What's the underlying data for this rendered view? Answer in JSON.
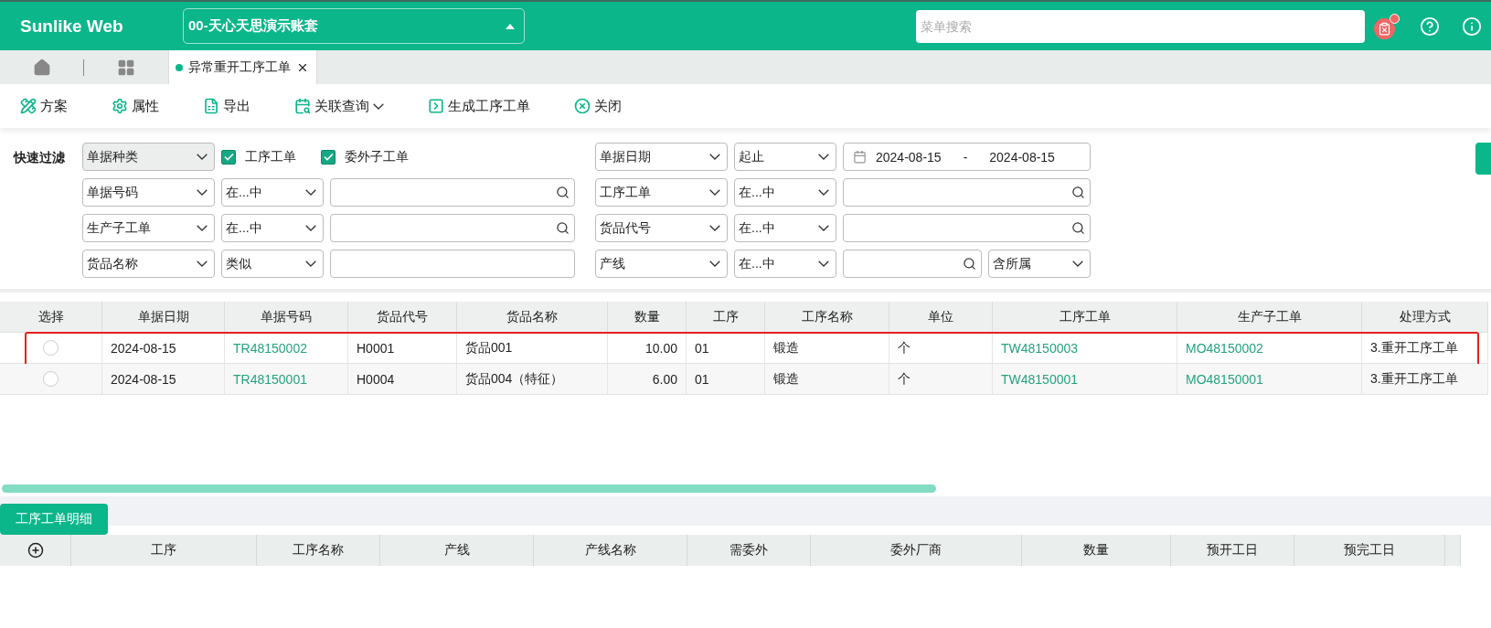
{
  "header": {
    "logo": "Sunlike Web",
    "account": {
      "value": "00-天心天思演示账套"
    },
    "search": {
      "placeholder": "菜单搜索"
    },
    "notice": {
      "unread": true
    }
  },
  "tabs": [
    {
      "label": "异常重开工序工单",
      "selected": true
    }
  ],
  "toolbar": [
    {
      "kind": "scheme",
      "label": "方案",
      "has_menu": false
    },
    {
      "kind": "property",
      "label": "属性",
      "has_menu": false
    },
    {
      "kind": "export",
      "label": "导出",
      "has_menu": false
    },
    {
      "kind": "query",
      "label": "关联查询",
      "has_menu": true
    },
    {
      "kind": "generate",
      "label": "生成工序工单",
      "has_menu": false
    },
    {
      "kind": "close",
      "label": "关闭",
      "has_menu": false
    }
  ],
  "filter": {
    "label": "快速过滤",
    "rows": [
      {
        "left": [
          {
            "kind": "select",
            "value": "单据种类",
            "disabled": true
          },
          {
            "kind": "checkbox",
            "label": "工序工单",
            "checked": true
          },
          {
            "kind": "checkbox",
            "label": "委外子工单",
            "checked": true
          }
        ],
        "right": [
          {
            "kind": "select",
            "value": "单据日期",
            "disabled": false
          },
          {
            "kind": "select",
            "value": "起止",
            "disabled": false
          },
          {
            "kind": "date_range",
            "from": "2024-08-15",
            "separator": "-",
            "to": "2024-08-15"
          }
        ]
      },
      {
        "left": [
          {
            "kind": "select",
            "value": "单据号码",
            "disabled": false
          },
          {
            "kind": "select",
            "value": "在...中",
            "disabled": false
          },
          {
            "kind": "search"
          }
        ],
        "right": [
          {
            "kind": "select",
            "value": "工序工单",
            "disabled": false
          },
          {
            "kind": "select",
            "value": "在...中",
            "disabled": false
          },
          {
            "kind": "search"
          }
        ]
      },
      {
        "left": [
          {
            "kind": "select",
            "value": "生产子工单",
            "disabled": false
          },
          {
            "kind": "select",
            "value": "在...中",
            "disabled": false
          },
          {
            "kind": "search"
          }
        ],
        "right": [
          {
            "kind": "select",
            "value": "货品代号",
            "disabled": false
          },
          {
            "kind": "select",
            "value": "在...中",
            "disabled": false
          },
          {
            "kind": "search"
          }
        ]
      },
      {
        "left": [
          {
            "kind": "select",
            "value": "货品名称",
            "disabled": false
          },
          {
            "kind": "select",
            "value": "类似",
            "disabled": false
          },
          {
            "kind": "input"
          }
        ],
        "right": [
          {
            "kind": "select",
            "value": "产线",
            "disabled": false
          },
          {
            "kind": "select",
            "value": "在...中",
            "disabled": false
          },
          {
            "kind": "search"
          },
          {
            "kind": "select",
            "value": "含所属",
            "disabled": false
          }
        ]
      }
    ]
  },
  "table": {
    "columns": [
      {
        "label": "选择"
      },
      {
        "label": "单据日期"
      },
      {
        "label": "单据号码",
        "link": true
      },
      {
        "label": "货品代号"
      },
      {
        "label": "货品名称"
      },
      {
        "label": "数量"
      },
      {
        "label": "工序"
      },
      {
        "label": "工序名称"
      },
      {
        "label": "单位"
      },
      {
        "label": "工序工单",
        "link": true
      },
      {
        "label": "生产子工单",
        "link": true
      },
      {
        "label": "处理方式"
      }
    ],
    "rows": [
      {
        "selected": false,
        "highlighted": true,
        "cells": [
          "",
          "2024-08-15",
          "TR48150002",
          "H0001",
          "货品001",
          "10.00",
          "01",
          "锻造",
          "个",
          "TW48150003",
          "MO48150002",
          "3.重开工序工单"
        ]
      },
      {
        "selected": false,
        "highlighted": false,
        "cells": [
          "",
          "2024-08-15",
          "TR48150001",
          "H0004",
          "货品004（特征）",
          "6.00",
          "01",
          "锻造",
          "个",
          "TW48150001",
          "MO48150001",
          "3.重开工序工单"
        ]
      }
    ]
  },
  "detail": {
    "tab": "工序工单明细",
    "columns": [
      "工序",
      "工序名称",
      "产线",
      "产线名称",
      "需委外",
      "委外厂商",
      "数量",
      "预开工日",
      "预完工日"
    ]
  }
}
